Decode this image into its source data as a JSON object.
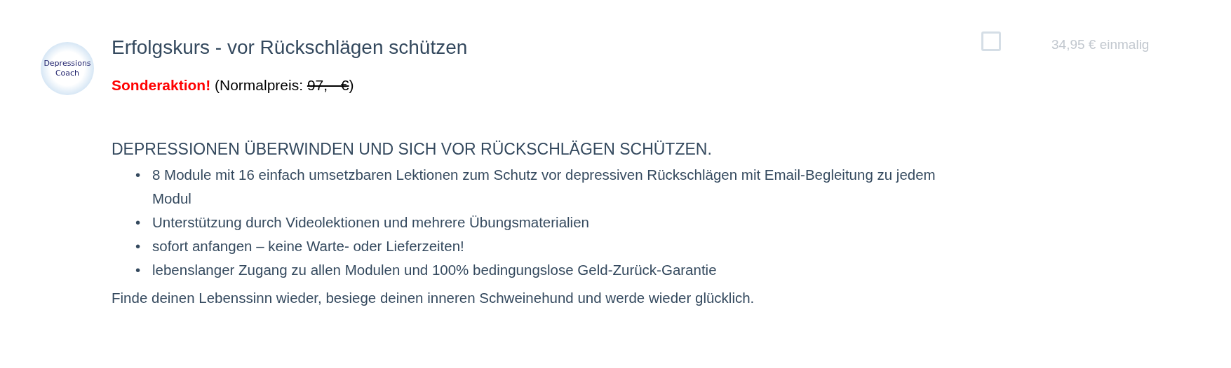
{
  "logo": {
    "lines": [
      "Depressions",
      "Coach"
    ]
  },
  "product": {
    "title": "Erfolgskurs - vor Rückschlägen schützen",
    "promo": {
      "highlight": "Sonderaktion!",
      "label": "(Normalpreis: ",
      "old_price": "97, - €",
      "suffix": ")"
    },
    "heading": "DEPRESSIONEN ÜBERWINDEN UND SICH VOR RÜCKSCHLÄGEN SCHÜTZEN.",
    "bullet_marker": "•",
    "bullets": [
      "8 Module mit 16 einfach umsetzbaren Lektionen zum Schutz vor depressiven Rückschlägen mit Email-Begleitung zu jedem Modul",
      "Unterstützung durch Videolektionen und mehrere Übungsmaterialien",
      "sofort anfangen – keine Warte- oder Lieferzeiten!",
      "lebenslanger Zugang zu allen Modulen und 100% bedingungslose Geld-Zurück-Garantie"
    ],
    "closing": "Finde deinen Lebenssinn wieder, besiege deinen inneren Schweinehund und werde wieder glücklich."
  },
  "select": {
    "checked": false
  },
  "price": "34,95 € einmalig"
}
